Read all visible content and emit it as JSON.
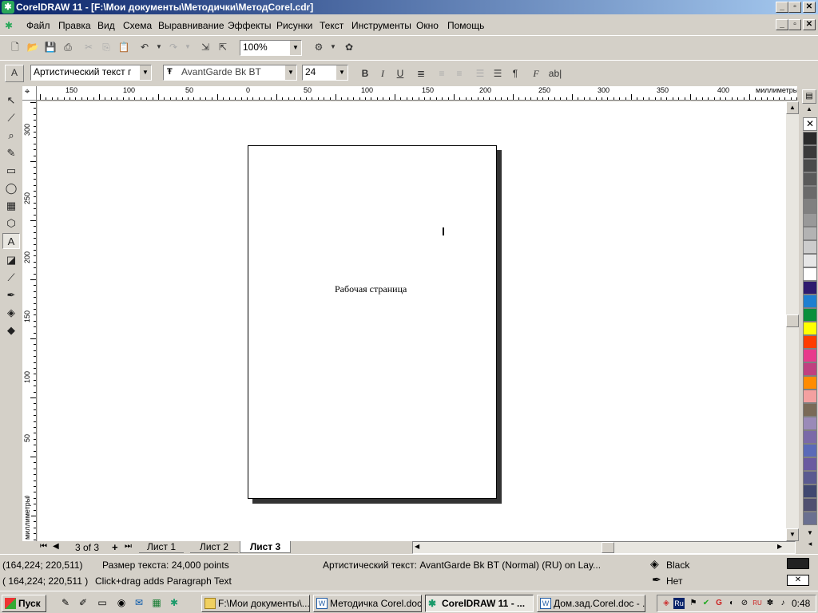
{
  "window": {
    "title": "CorelDRAW 11 - [F:\\Мои документы\\Методички\\МетодCorel.cdr]",
    "controls": {
      "minimize": "_",
      "maximize": "▫",
      "close": "✕"
    }
  },
  "menu": [
    "Файл",
    "Правка",
    "Вид",
    "Схема",
    "Выравнивание",
    "Эффекты",
    "Рисунки",
    "Текст",
    "Инструменты",
    "Окно",
    "Помощь"
  ],
  "standard_toolbar": {
    "zoom_value": "100%"
  },
  "property_bar": {
    "text_type": "Артистический текст г",
    "font_name": "AvantGarde Bk BT",
    "font_size": "24",
    "bold": "B",
    "italic": "I",
    "underline": "U",
    "format_symbol": "¶",
    "font_icon": "F",
    "edit_text": "ab|"
  },
  "rulers": {
    "horizontal_labels": [
      "150",
      "100",
      "50",
      "0",
      "50",
      "100",
      "150",
      "200",
      "250",
      "300",
      "350",
      "400"
    ],
    "unit": "миллиметры",
    "vertical_labels": [
      "300",
      "250",
      "200",
      "150",
      "100",
      "50",
      "0"
    ]
  },
  "document": {
    "page_text": "Рабочая страница"
  },
  "page_nav": {
    "counter": "3 of 3",
    "tabs": [
      "Лист 1",
      "Лист 2",
      "Лист 3"
    ],
    "active_tab": "Лист 3"
  },
  "palette_colors": [
    "#2b2b2b",
    "#3a3a3a",
    "#4a4a4a",
    "#5a5a5a",
    "#6a6a6a",
    "#808080",
    "#999999",
    "#b3b3b3",
    "#cccccc",
    "#e6e6e6",
    "#ffffff",
    "#2e1a6e",
    "#1e7fd0",
    "#0a8f3c",
    "#ffff00",
    "#ff3c00",
    "#e83a8c",
    "#c04080",
    "#ff8c00",
    "#f4a0a0",
    "#7a6a58",
    "#9a8ab8",
    "#7a6aa8",
    "#5a6ab8",
    "#6a5aa0",
    "#5a5a90",
    "#404870",
    "#505070",
    "#6a7090"
  ],
  "status": {
    "line1_coords": "(164,224; 220,511)",
    "line1_size": "Размер текста: 24,000 points",
    "line1_object": "Артистический текст: AvantGarde Bk BT (Normal) (RU) on Lay...",
    "fill_label": "Black",
    "line2_coords": "( 164,224; 220,511 )",
    "line2_hint": "Click+drag adds Paragraph Text",
    "outline_label": "Нет"
  },
  "taskbar": {
    "start": "Пуск",
    "tasks": [
      "F:\\Мои документы\\...",
      "Методичка Corel.doc...",
      "CorelDRAW 11 - ...",
      "Дом.зад.Corel.doc - ..."
    ],
    "active_task": "CorelDRAW 11 - ...",
    "lang": "Ru",
    "time": "0:48"
  }
}
